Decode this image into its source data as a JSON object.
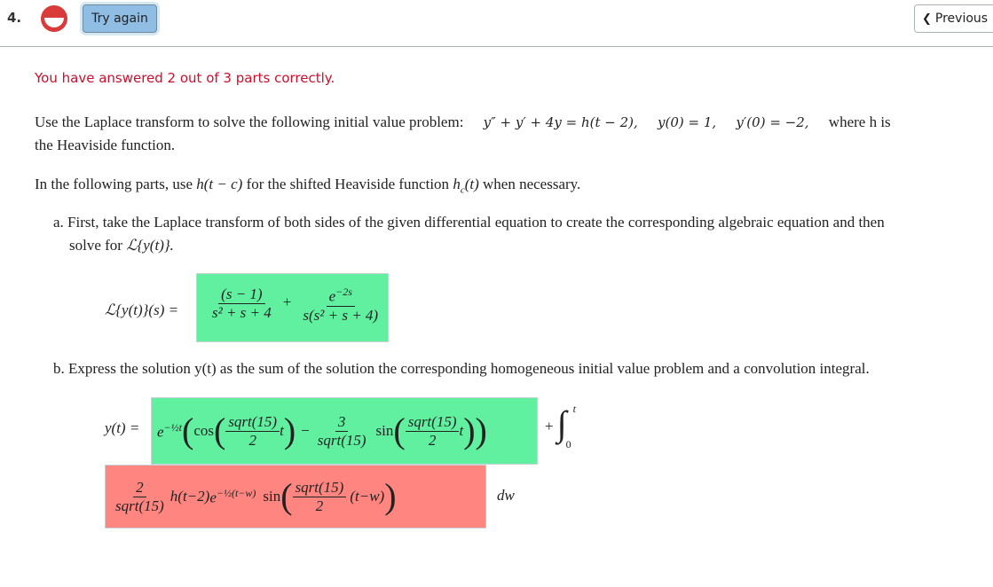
{
  "header": {
    "question_number": "4.",
    "score_icon": "partial-score-icon",
    "try_again_label": "Try again",
    "previous_label": "Previous",
    "previous_icon": "chevron-left-icon"
  },
  "status_message": "You have answered 2 out of 3 parts correctly.",
  "problem": {
    "intro": "Use the Laplace transform to solve the following initial value problem:",
    "equation": "y″ + y′ + 4y = h(t − 2),",
    "condition1": "y(0) = 1,",
    "condition2": "y′(0) = −2,",
    "where_text": "where h is",
    "line2": "the Heaviside function.",
    "note_prefix": "In the following parts, use",
    "note_math1": "h(t − c)",
    "note_mid": "for the shifted Heaviside function",
    "note_math2": "h",
    "note_math2_sub": "c",
    "note_math2_arg": "(t)",
    "note_suffix": "when necessary."
  },
  "part_a": {
    "label": "a.",
    "text_line1": "First, take the Laplace transform of both sides of the given differential equation to create the corresponding algebraic equation and then",
    "text_line2_prefix": "solve for",
    "text_line2_math": "ℒ{y(t)}.",
    "lhs": "ℒ{y(t)}(s) =",
    "answer": {
      "status": "correct",
      "term1_num": "(s − 1)",
      "term1_den": "s² + s + 4",
      "plus": "+",
      "term2_num": "e",
      "term2_num_exp": "−2s",
      "term2_den": "s(s² + s + 4)"
    }
  },
  "part_b": {
    "label": "b.",
    "text": "Express the solution y(t) as the sum of the solution the corresponding homogeneous initial value problem and a convolution integral.",
    "lhs": "y(t) =",
    "homogeneous_answer": {
      "status": "correct",
      "exp_base": "e",
      "exp_power": "−½t",
      "cos_label": "cos",
      "cos_arg_num": "sqrt(15)",
      "cos_arg_den": "2",
      "cos_arg_var": "t",
      "minus": "−",
      "coef_num": "3",
      "coef_den": "sqrt(15)",
      "sin_label": "sin",
      "sin_arg_num": "sqrt(15)",
      "sin_arg_den": "2",
      "sin_arg_var": "t"
    },
    "integral": {
      "plus": "+",
      "symbol": "∫",
      "lower": "0",
      "upper": "t",
      "differential": "dw"
    },
    "integrand_answer": {
      "status": "incorrect",
      "coef_num": "2",
      "coef_den": "sqrt(15)",
      "heaviside": "h(t−2)",
      "exp_base": "e",
      "exp_power": "−½(t−w)",
      "sin_label": "sin",
      "sin_arg_num": "sqrt(15)",
      "sin_arg_den": "2",
      "sin_arg_var": "(t−w)"
    }
  },
  "colors": {
    "correct": "#60f0a0",
    "incorrect": "#ff8580",
    "status_text": "#c8102e",
    "button": "#8fbde4"
  }
}
